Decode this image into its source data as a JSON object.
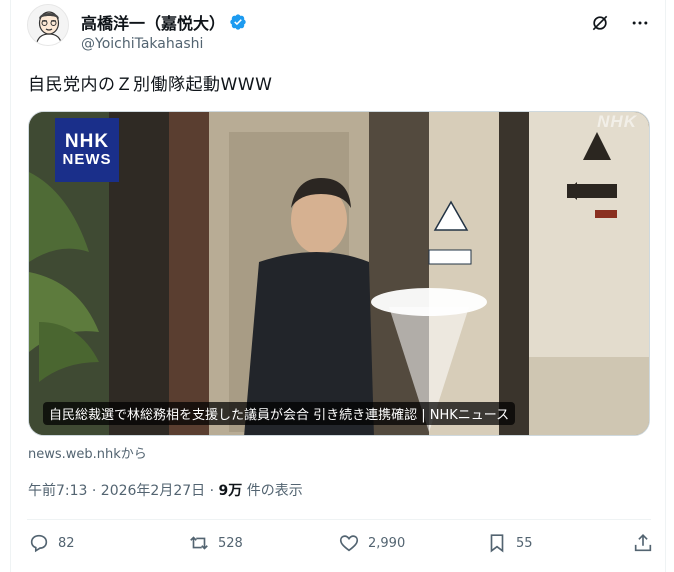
{
  "author": {
    "name": "高橋洋一（嘉悦大）",
    "handle": "@YoichiTakahashi"
  },
  "post": {
    "text": "自民党内のＺ別働隊起動WWW"
  },
  "media": {
    "logo_line1": "NHK",
    "logo_line2": "NEWS",
    "watermark": "NHK",
    "caption": "自民総裁選で林総務相を支援した議員が会合 引き続き連携確認 | NHKニュース"
  },
  "source": "news.web.nhkから",
  "meta": {
    "time": "午前7:13 · 2026年2月27日 · ",
    "views": "9万",
    "views_suffix": " 件の表示"
  },
  "actions": {
    "replies": "82",
    "reposts": "528",
    "likes": "2,990",
    "bookmarks": "55"
  },
  "colors": {
    "verified": "#1d9bf0",
    "secondary_text": "#536471",
    "primary_text": "#0f1419",
    "nhk_blue": "#1a2f8a"
  },
  "icons": [
    "grok-icon",
    "more-icon",
    "reply-icon",
    "repost-icon",
    "like-icon",
    "bookmark-icon",
    "share-icon",
    "verified-icon"
  ]
}
